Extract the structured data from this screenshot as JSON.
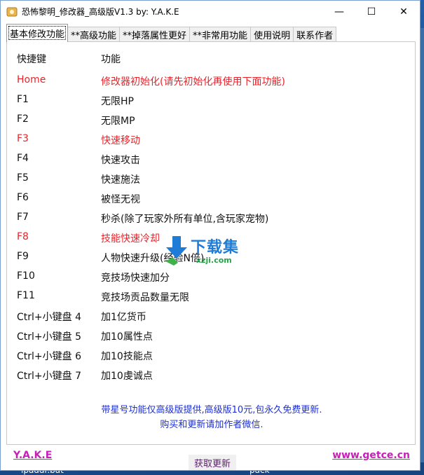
{
  "window": {
    "title": "恐怖黎明_修改器_高级版V1.3 by: Y.A.K.E",
    "controls": {
      "minimize": "—",
      "maximize": "☐",
      "close": "✕"
    }
  },
  "tabs": [
    {
      "label": "基本修改功能",
      "active": true
    },
    {
      "label": "**高级功能",
      "active": false
    },
    {
      "label": "**掉落属性更好",
      "active": false
    },
    {
      "label": "**非常用功能",
      "active": false
    },
    {
      "label": "使用说明",
      "active": false
    },
    {
      "label": "联系作者",
      "active": false
    }
  ],
  "table": {
    "header": {
      "key": "快捷键",
      "func": "功能"
    },
    "rows": [
      {
        "key": "Home",
        "func": "修改器初始化(请先初始化再使用下面功能)",
        "highlight": true
      },
      {
        "key": "F1",
        "func": "无限HP",
        "highlight": false
      },
      {
        "key": "F2",
        "func": "无限MP",
        "highlight": false
      },
      {
        "key": "F3",
        "func": "快速移动",
        "highlight": true
      },
      {
        "key": "F4",
        "func": "快速攻击",
        "highlight": false
      },
      {
        "key": "F5",
        "func": "快速施法",
        "highlight": false
      },
      {
        "key": "F6",
        "func": "被怪无视",
        "highlight": false
      },
      {
        "key": "F7",
        "func": "秒杀(除了玩家外所有单位,含玩家宠物)",
        "highlight": false
      },
      {
        "key": "F8",
        "func": "技能快速冷却",
        "highlight": true
      },
      {
        "key": "F9",
        "func": "人物快速升级(经验N倍)",
        "highlight": false
      },
      {
        "key": "F10",
        "func": "竞技场快速加分",
        "highlight": false
      },
      {
        "key": "F11",
        "func": "竞技场贡品数量无限",
        "highlight": false
      },
      {
        "key": "Ctrl+小键盘 4",
        "func": "加1亿货币",
        "highlight": false
      },
      {
        "key": "Ctrl+小键盘 5",
        "func": "加10属性点",
        "highlight": false
      },
      {
        "key": "Ctrl+小键盘 6",
        "func": "加10技能点",
        "highlight": false
      },
      {
        "key": "Ctrl+小键盘 7",
        "func": "加10虔诚点",
        "highlight": false
      }
    ]
  },
  "notice": {
    "line1": "带星号功能仅高级版提供,高级版10元,包永久免费更新.",
    "line2": "购买和更新请加作者微信."
  },
  "footer": {
    "author": "Y.A.K.E",
    "update_button": "获取更新",
    "website": "www.getce.cn"
  },
  "watermark": {
    "text": "下载集",
    "sub": "xzji.com"
  },
  "desktop": {
    "file1": "ipaddr.bat",
    "file2": "pack"
  },
  "colors": {
    "highlight": "#e8232a",
    "notice": "#1c2fd6",
    "footer_link": "#c81fb8"
  }
}
